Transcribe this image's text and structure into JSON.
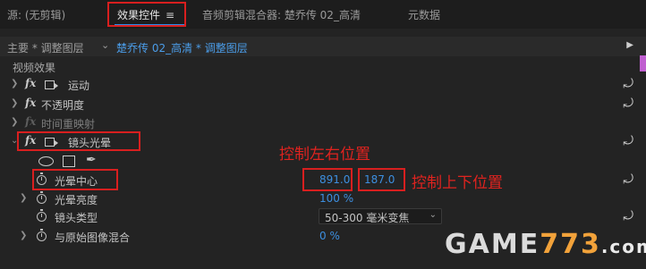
{
  "tabs": [
    {
      "label": "源: (无剪辑)"
    },
    {
      "label": "效果控件"
    },
    {
      "label": "音频剪辑混合器: 楚乔传 02_高清"
    },
    {
      "label": "元数据"
    }
  ],
  "tab_menu_icon": "≡",
  "sequence_bar": {
    "left_label": "主要 * 调整图层",
    "right_link": "楚乔传 02_高清 * 调整图层"
  },
  "section_header": "视频效果",
  "effects": {
    "motion": "运动",
    "opacity": "不透明度",
    "time_remap": "时间重映射",
    "lens_flare": "镜头光晕"
  },
  "params": {
    "flare_center": {
      "label": "光晕中心",
      "x": "891.0",
      "y": "187.0"
    },
    "flare_brightness": {
      "label": "光晕亮度",
      "value": "100 %"
    },
    "lens_type": {
      "label": "镜头类型",
      "selected": "50-300 毫米变焦"
    },
    "blend_original": {
      "label": "与原始图像混合",
      "value": "0 %"
    }
  },
  "annotations": {
    "left_right": "控制左右位置",
    "up_down": "控制上下位置"
  },
  "watermark": {
    "prefix": "GAME",
    "number": "773",
    "suffix": ".com"
  },
  "colors": {
    "accent_blue": "#2d8ceb",
    "value_blue": "#3d8fe0",
    "annotation_red": "#d81f1f",
    "panel_bg": "#232323"
  },
  "icons": [
    "hamburger-menu-icon",
    "chevron-down-icon",
    "fx-icon",
    "motion-transform-icon",
    "reset-icon",
    "stopwatch-icon",
    "ellipse-mask-icon",
    "rectangle-mask-icon",
    "pen-mask-icon"
  ]
}
